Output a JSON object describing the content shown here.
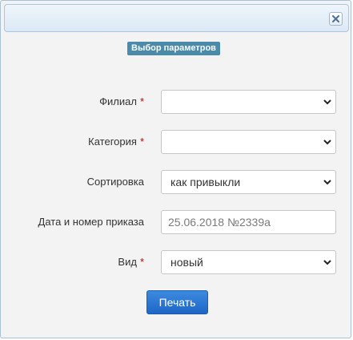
{
  "dialog": {
    "close_icon": "close-icon",
    "section_title": "Выбор параметров"
  },
  "form": {
    "branch": {
      "label": "Филиал",
      "required": "*",
      "value": ""
    },
    "category": {
      "label": "Категория",
      "required": "*",
      "value": ""
    },
    "sort": {
      "label": "Сортировка",
      "value": "как привыкли"
    },
    "order": {
      "label": "Дата и номер приказа",
      "placeholder": "25.06.2018 №2339а"
    },
    "type": {
      "label": "Вид",
      "required": "*",
      "value": "новый"
    }
  },
  "actions": {
    "print_label": "Печать"
  },
  "colors": {
    "badge": "#4a8bab",
    "required": "#cc0000",
    "primary_button": "#2a74d2"
  }
}
